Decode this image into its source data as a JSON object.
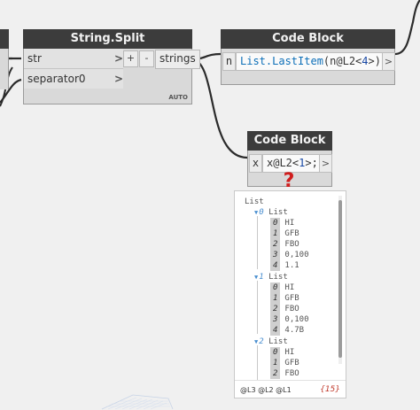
{
  "string_split_node": {
    "title": "String.Split",
    "inputs": [
      "str",
      "separator0"
    ],
    "output": "strings",
    "lacing": "AUTO",
    "add_label": "+",
    "remove_label": "-",
    "port_arrow": ">"
  },
  "code_block_1": {
    "title": "Code Block",
    "input_var": "n",
    "code": {
      "fn": "List.LastItem",
      "pre": "(n@L2<",
      "num": "4",
      "post": ">);"
    },
    "output_arrow": ">"
  },
  "code_block_2": {
    "title": "Code Block",
    "input_var": "x",
    "code": {
      "pre": "x@L2<",
      "num": "1",
      "post": ">;"
    },
    "output_arrow": ">"
  },
  "annotation": {
    "symbol": "?"
  },
  "preview": {
    "root_label": "List",
    "groups": [
      {
        "index": "0",
        "label": "List",
        "items": [
          {
            "i": "0",
            "v": "HI"
          },
          {
            "i": "1",
            "v": "GFB"
          },
          {
            "i": "2",
            "v": "FBO"
          },
          {
            "i": "3",
            "v": "0,100"
          },
          {
            "i": "4",
            "v": "1.1"
          }
        ]
      },
      {
        "index": "1",
        "label": "List",
        "items": [
          {
            "i": "0",
            "v": "HI"
          },
          {
            "i": "1",
            "v": "GFB"
          },
          {
            "i": "2",
            "v": "FBO"
          },
          {
            "i": "3",
            "v": "0,100"
          },
          {
            "i": "4",
            "v": "4.7B"
          }
        ]
      },
      {
        "index": "2",
        "label": "List",
        "items": [
          {
            "i": "0",
            "v": "HI"
          },
          {
            "i": "1",
            "v": "GFB"
          },
          {
            "i": "2",
            "v": "FBO"
          }
        ]
      }
    ],
    "levels": "@L3 @L2 @L1",
    "count": "{15}"
  },
  "colors": {
    "canvas": "#f0f0f0",
    "header": "#3c3c3c",
    "body": "#d9d9d9",
    "wire": "#2b2b2b",
    "annotation": "#d01d1d"
  }
}
